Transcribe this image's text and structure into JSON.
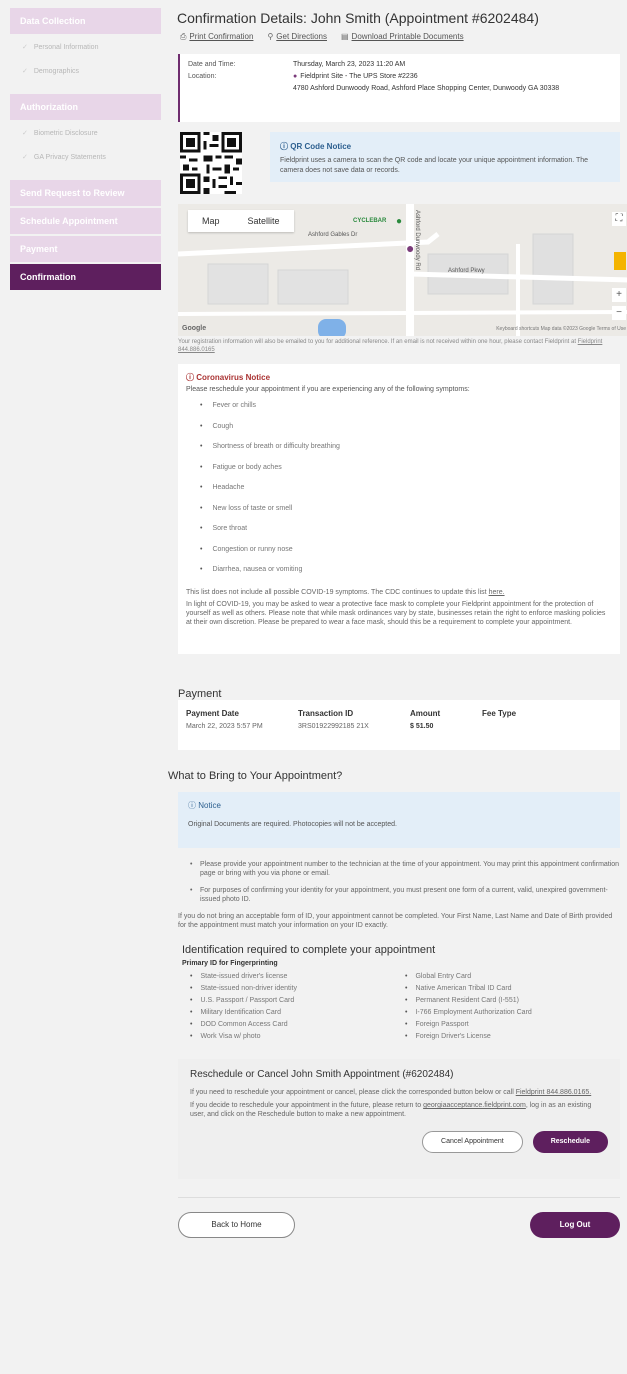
{
  "sidebar": {
    "data_collection": "Data Collection",
    "personal_information": "Personal Information",
    "demographics": "Demographics",
    "authorization": "Authorization",
    "biometric_disclosure": "Biometric Disclosure",
    "ga_privacy": "GA Privacy Statements",
    "send_request": "Send Request to Review",
    "schedule": "Schedule Appointment",
    "payment": "Payment",
    "confirmation": "Confirmation"
  },
  "header": {
    "title": "Confirmation Details: John Smith (Appointment #6202484)",
    "print": "Print Confirmation",
    "directions": "Get Directions",
    "download": "Download Printable Documents"
  },
  "appointment": {
    "date_label": "Date and Time:",
    "date_value": "Thursday, March 23, 2023 11:20 AM",
    "location_label": "Location:",
    "site": "Fieldprint Site - The UPS Store #2236",
    "address": "4780 Ashford Dunwoody Road, Ashford Place Shopping Center, Dunwoody GA 30338"
  },
  "qr_notice": {
    "title": "QR Code Notice",
    "body": "Fieldprint uses a camera to scan the QR code and locate your unique appointment information. The camera does not save data or records."
  },
  "map": {
    "tab_map": "Map",
    "tab_satellite": "Satellite",
    "google": "Google",
    "attribution": "Keyboard shortcuts   Map data ©2023 Google   Terms of Use",
    "poi": "CYCLEBAR",
    "street1": "Ashford Gables Dr",
    "street2": "Ashford Dunwoody Rd",
    "street3": "Ashford Pkwy"
  },
  "registration_note": {
    "text": "Your registration information will also be emailed to you for additional reference. If an email is not received within one hour, please contact Fieldprint at",
    "link": "Fieldprint 844.886.0165"
  },
  "covid": {
    "title": "Coronavirus Notice",
    "intro": "Please reschedule your appointment if you are experiencing any of the following symptoms:",
    "symptoms": [
      "Fever or chills",
      "Cough",
      "Shortness of breath or difficulty breathing",
      "Fatigue or body aches",
      "Headache",
      "New loss of taste or smell",
      "Sore throat",
      "Congestion or runny nose",
      "Diarrhea, nausea or vomiting"
    ],
    "note": "This list does not include all possible COVID-19 symptoms. The CDC continues to update this list",
    "note_link": "here.",
    "mask": "In light of COVID-19, you may be asked to wear a protective face mask to complete your Fieldprint appointment for the protection of yourself as well as others. Please note that while mask ordinances vary by state, businesses retain the right to enforce masking policies at their own discretion. Please be prepared to wear a face mask, should this be a requirement to complete your appointment."
  },
  "payment": {
    "title": "Payment",
    "headers": [
      "Payment Date",
      "Transaction ID",
      "Amount",
      "Fee Type"
    ],
    "row": [
      "March 22, 2023 5:57 PM",
      "3RS01922992185 21X",
      "$ 51.50",
      ""
    ]
  },
  "bring": {
    "title": "What to Bring to Your Appointment?",
    "notice_title": "Notice",
    "notice_body": "Original Documents are required. Photocopies will not be accepted.",
    "bullet1": "Please provide your appointment number to the technician at the time of your appointment. You may print this appointment confirmation page or bring with you via phone or email.",
    "bullet2": "For purposes of confirming your identity for your appointment, you must present one form of a current, valid, unexpired government-issued photo ID.",
    "para": "If you do not bring an acceptable form of ID, your appointment cannot be completed. Your First Name, Last Name and Date of Birth provided for the appointment must match your information on your ID exactly."
  },
  "identification": {
    "title": "Identification required to complete your appointment",
    "subtitle": "Primary ID for Fingerprinting",
    "col1": [
      "State-issued driver's license",
      "State-issued non-driver identity",
      "U.S. Passport / Passport Card",
      "Military Identification Card",
      "DOD Common Access Card",
      "Work Visa w/ photo"
    ],
    "col2": [
      "Global Entry Card",
      "Native American Tribal ID Card",
      "Permanent Resident Card (I-551)",
      "I-766 Employment Authorization Card",
      "Foreign Passport",
      "Foreign Driver's License"
    ]
  },
  "reschedule": {
    "title": "Reschedule or Cancel John Smith Appointment (#6202484)",
    "p1": "If you need to reschedule your appointment or cancel, please click the corresponded button below or call",
    "p1_link": "Fieldprint 844.886.0165.",
    "p2_a": "If you decide to reschedule your appointment in the future, please return to",
    "p2_link": "georgiaacceptance.fieldprint.com",
    "p2_b": ", log in as an existing user, and click on the Reschedule button to make a new appointment.",
    "cancel": "Cancel Appointment",
    "reschedule": "Reschedule"
  },
  "footer": {
    "back": "Back to Home",
    "logout": "Log Out"
  },
  "colors": {
    "brand": "#5e1f5e",
    "brand_light": "#e8d6e8",
    "notice_bg": "#e3eef8"
  }
}
